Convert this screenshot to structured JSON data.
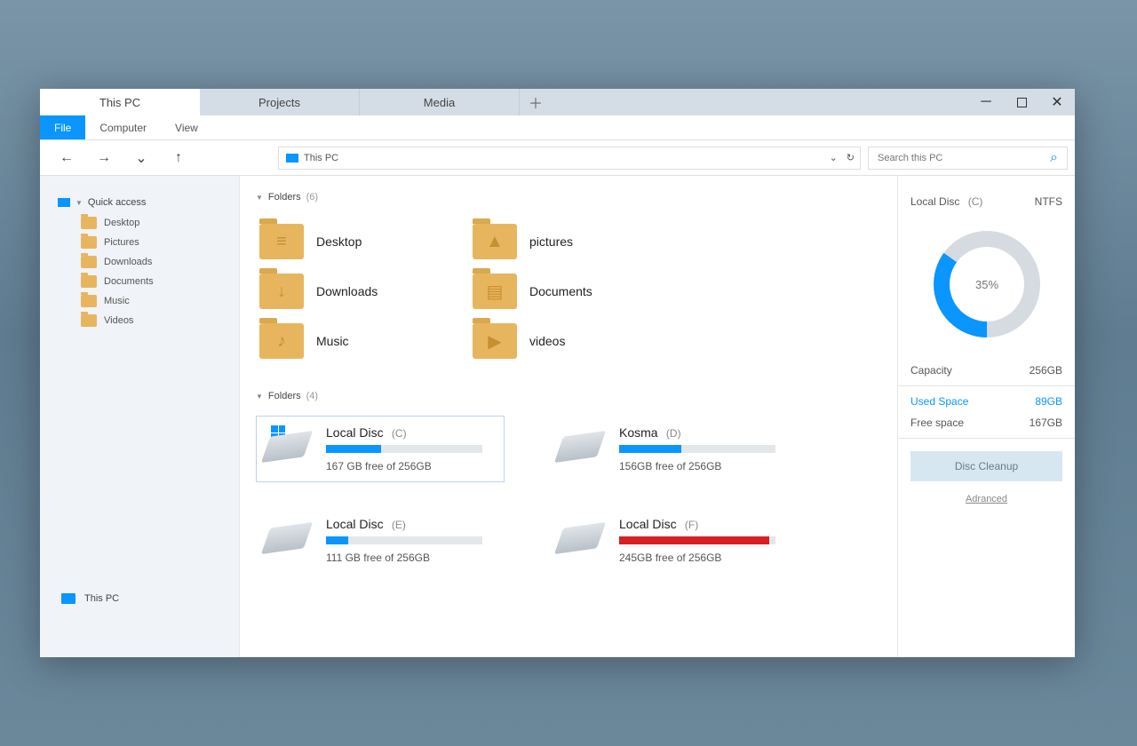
{
  "tabs": [
    {
      "label": "This PC",
      "active": true
    },
    {
      "label": "Projects",
      "active": false
    },
    {
      "label": "Media",
      "active": false
    }
  ],
  "menu": {
    "file": "File",
    "computer": "Computer",
    "view": "View"
  },
  "address": {
    "text": "This PC"
  },
  "search": {
    "placeholder": "Search this PC"
  },
  "sidebar": {
    "quick_access": "Quick access",
    "items": [
      "Desktop",
      "Pictures",
      "Downloads",
      "Documents",
      "Music",
      "Videos"
    ],
    "this_pc": "This PC"
  },
  "section_folders": {
    "title": "Folders",
    "count": "(6)"
  },
  "folders": [
    {
      "label": "Desktop",
      "icon": "lines"
    },
    {
      "label": "pictures",
      "icon": "image"
    },
    {
      "label": "Downloads",
      "icon": "download"
    },
    {
      "label": "Documents",
      "icon": "doc"
    },
    {
      "label": "Music",
      "icon": "music"
    },
    {
      "label": "videos",
      "icon": "video"
    }
  ],
  "section_drives": {
    "title": "Folders",
    "count": "(4)"
  },
  "drives": [
    {
      "name": "Local Disc",
      "letter": "(C)",
      "status": "167 GB free of 256GB",
      "pct": 35,
      "selected": true,
      "winlogo": true,
      "color": "blue"
    },
    {
      "name": "Kosma",
      "letter": "(D)",
      "status": "156GB free of 256GB",
      "pct": 40,
      "selected": false,
      "winlogo": false,
      "color": "blue"
    },
    {
      "name": "Local Disc",
      "letter": "(E)",
      "status": "111 GB free of 256GB",
      "pct": 14,
      "selected": false,
      "winlogo": false,
      "color": "blue"
    },
    {
      "name": "Local Disc",
      "letter": "(F)",
      "status": "245GB free of 256GB",
      "pct": 96,
      "selected": false,
      "winlogo": false,
      "color": "red"
    }
  ],
  "details": {
    "name": "Local Disc",
    "letter": "(C)",
    "fs": "NTFS",
    "ring_label": "35%",
    "capacity_label": "Capacity",
    "capacity_value": "256GB",
    "used_label": "Used Space",
    "used_value": "89GB",
    "free_label": "Free space",
    "free_value": "167GB",
    "cleanup": "Disc Cleanup",
    "advanced": "Adranced"
  }
}
